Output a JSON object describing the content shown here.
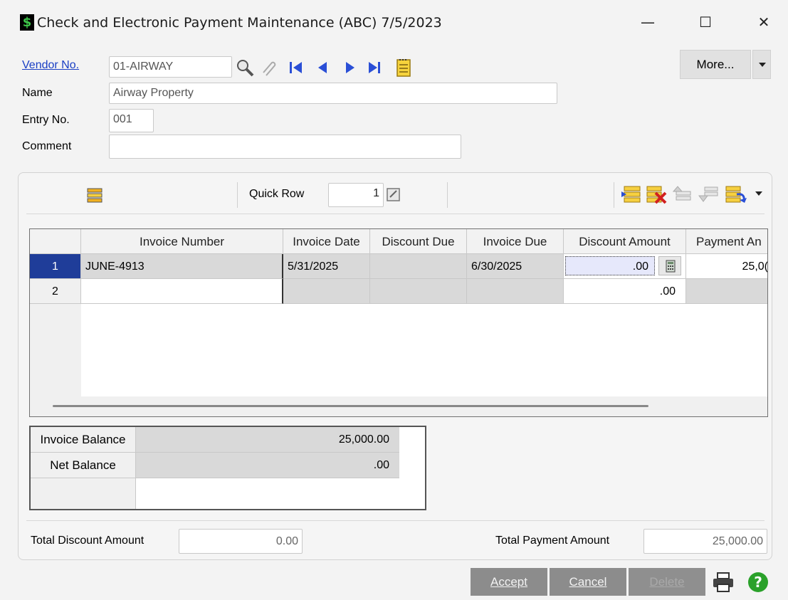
{
  "window": {
    "title": "Check and Electronic Payment Maintenance (ABC) 7/5/2023",
    "app_icon": "$",
    "minimize": "—",
    "maximize": "☐",
    "close": "✕"
  },
  "header": {
    "vendor_label": "Vendor No.",
    "vendor_value": "01-AIRWAY",
    "name_label": "Name",
    "name_value": "Airway Property",
    "entry_label": "Entry No.",
    "entry_value": "001",
    "comment_label": "Comment",
    "comment_value": "",
    "more_label": "More..."
  },
  "toolbar": {
    "quick_row_label": "Quick Row",
    "quick_row_value": "1"
  },
  "grid": {
    "columns": [
      "Invoice Number",
      "Invoice Date",
      "Discount Due",
      "Invoice Due",
      "Discount Amount",
      "Payment An"
    ],
    "rows": [
      {
        "num": "1",
        "invoice_number": "JUNE-4913",
        "invoice_date": "5/31/2025",
        "discount_due": "",
        "invoice_due": "6/30/2025",
        "discount_amount": ".00",
        "payment_amount": "25,0("
      },
      {
        "num": "2",
        "invoice_number": "",
        "invoice_date": "",
        "discount_due": "",
        "invoice_due": "",
        "discount_amount": ".00",
        "payment_amount": ""
      }
    ]
  },
  "balance": {
    "invoice_balance_label": "Invoice Balance",
    "invoice_balance_value": "25,000.00",
    "net_balance_label": "Net Balance",
    "net_balance_value": ".00"
  },
  "totals": {
    "discount_label": "Total Discount Amount",
    "discount_value": "0.00",
    "payment_label": "Total Payment Amount",
    "payment_value": "25,000.00"
  },
  "buttons": {
    "accept": "Accept",
    "cancel": "Cancel",
    "delete": "Delete"
  },
  "colors": {
    "accent": "#1a3fc4",
    "selected_row": "#1f3d99",
    "button_gray": "#8c8c8c",
    "help_green": "#2aa12a"
  }
}
